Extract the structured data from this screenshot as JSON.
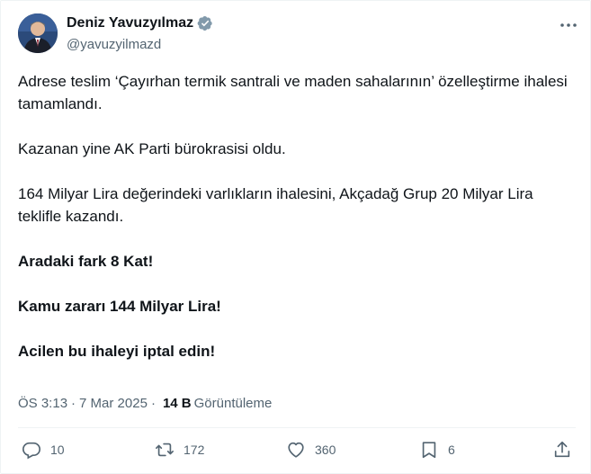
{
  "author": {
    "display_name": "Deniz Yavuzyılmaz",
    "handle": "@yavuzyilmazd",
    "verified_color": "#829aab"
  },
  "tweet": {
    "lines": [
      "Adrese teslim ‘Çayırhan termik santrali ve maden sahalarının’ özelleştirme ihalesi tamamlandı.",
      "Kazanan yine AK Parti bürokrasisi oldu.",
      "164 Milyar Lira değerindeki varlıkların ihalesini, Akçadağ Grup 20 Milyar Lira teklifle kazandı.",
      "Aradaki fark 8 Kat!",
      "Kamu zararı 144 Milyar Lira!",
      "Acilen bu ihaleyi iptal edin!"
    ]
  },
  "meta": {
    "time": "ÖS 3:13",
    "separator": "·",
    "date": "7 Mar 2025",
    "separator2": "·",
    "views_count": "14 B",
    "views_label": "Görüntüleme"
  },
  "actions": {
    "reply_count": "10",
    "retweet_count": "172",
    "like_count": "360",
    "bookmark_count": "6"
  },
  "icons": {
    "more": "more-horizontal-icon",
    "reply": "reply-icon",
    "retweet": "retweet-icon",
    "like": "heart-icon",
    "bookmark": "bookmark-icon",
    "share": "share-icon"
  },
  "colors": {
    "text": "#0f1419",
    "secondary": "#536471",
    "divider": "#eff3f4"
  }
}
